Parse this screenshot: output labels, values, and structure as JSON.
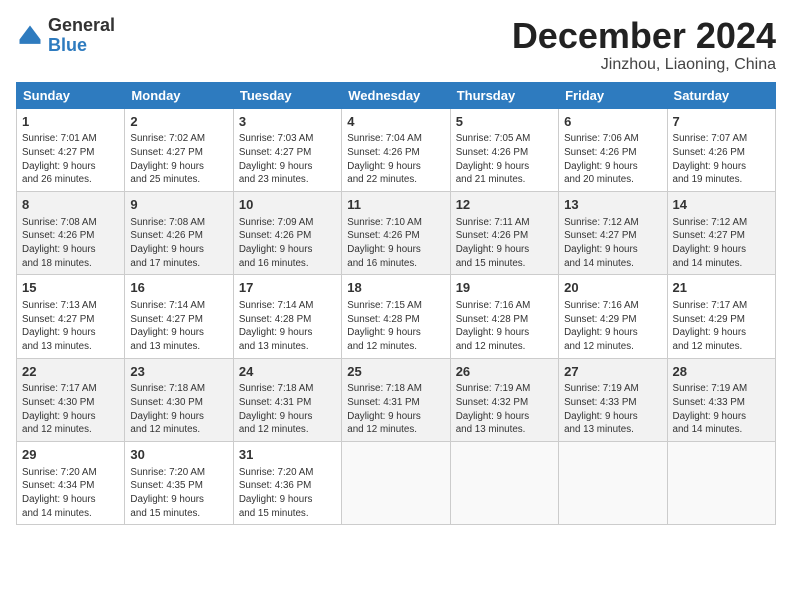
{
  "header": {
    "logo_general": "General",
    "logo_blue": "Blue",
    "month_title": "December 2024",
    "location": "Jinzhou, Liaoning, China"
  },
  "weekdays": [
    "Sunday",
    "Monday",
    "Tuesday",
    "Wednesday",
    "Thursday",
    "Friday",
    "Saturday"
  ],
  "rows": [
    [
      {
        "day": "1",
        "info": "Sunrise: 7:01 AM\nSunset: 4:27 PM\nDaylight: 9 hours\nand 26 minutes."
      },
      {
        "day": "2",
        "info": "Sunrise: 7:02 AM\nSunset: 4:27 PM\nDaylight: 9 hours\nand 25 minutes."
      },
      {
        "day": "3",
        "info": "Sunrise: 7:03 AM\nSunset: 4:27 PM\nDaylight: 9 hours\nand 23 minutes."
      },
      {
        "day": "4",
        "info": "Sunrise: 7:04 AM\nSunset: 4:26 PM\nDaylight: 9 hours\nand 22 minutes."
      },
      {
        "day": "5",
        "info": "Sunrise: 7:05 AM\nSunset: 4:26 PM\nDaylight: 9 hours\nand 21 minutes."
      },
      {
        "day": "6",
        "info": "Sunrise: 7:06 AM\nSunset: 4:26 PM\nDaylight: 9 hours\nand 20 minutes."
      },
      {
        "day": "7",
        "info": "Sunrise: 7:07 AM\nSunset: 4:26 PM\nDaylight: 9 hours\nand 19 minutes."
      }
    ],
    [
      {
        "day": "8",
        "info": "Sunrise: 7:08 AM\nSunset: 4:26 PM\nDaylight: 9 hours\nand 18 minutes."
      },
      {
        "day": "9",
        "info": "Sunrise: 7:08 AM\nSunset: 4:26 PM\nDaylight: 9 hours\nand 17 minutes."
      },
      {
        "day": "10",
        "info": "Sunrise: 7:09 AM\nSunset: 4:26 PM\nDaylight: 9 hours\nand 16 minutes."
      },
      {
        "day": "11",
        "info": "Sunrise: 7:10 AM\nSunset: 4:26 PM\nDaylight: 9 hours\nand 16 minutes."
      },
      {
        "day": "12",
        "info": "Sunrise: 7:11 AM\nSunset: 4:26 PM\nDaylight: 9 hours\nand 15 minutes."
      },
      {
        "day": "13",
        "info": "Sunrise: 7:12 AM\nSunset: 4:27 PM\nDaylight: 9 hours\nand 14 minutes."
      },
      {
        "day": "14",
        "info": "Sunrise: 7:12 AM\nSunset: 4:27 PM\nDaylight: 9 hours\nand 14 minutes."
      }
    ],
    [
      {
        "day": "15",
        "info": "Sunrise: 7:13 AM\nSunset: 4:27 PM\nDaylight: 9 hours\nand 13 minutes."
      },
      {
        "day": "16",
        "info": "Sunrise: 7:14 AM\nSunset: 4:27 PM\nDaylight: 9 hours\nand 13 minutes."
      },
      {
        "day": "17",
        "info": "Sunrise: 7:14 AM\nSunset: 4:28 PM\nDaylight: 9 hours\nand 13 minutes."
      },
      {
        "day": "18",
        "info": "Sunrise: 7:15 AM\nSunset: 4:28 PM\nDaylight: 9 hours\nand 12 minutes."
      },
      {
        "day": "19",
        "info": "Sunrise: 7:16 AM\nSunset: 4:28 PM\nDaylight: 9 hours\nand 12 minutes."
      },
      {
        "day": "20",
        "info": "Sunrise: 7:16 AM\nSunset: 4:29 PM\nDaylight: 9 hours\nand 12 minutes."
      },
      {
        "day": "21",
        "info": "Sunrise: 7:17 AM\nSunset: 4:29 PM\nDaylight: 9 hours\nand 12 minutes."
      }
    ],
    [
      {
        "day": "22",
        "info": "Sunrise: 7:17 AM\nSunset: 4:30 PM\nDaylight: 9 hours\nand 12 minutes."
      },
      {
        "day": "23",
        "info": "Sunrise: 7:18 AM\nSunset: 4:30 PM\nDaylight: 9 hours\nand 12 minutes."
      },
      {
        "day": "24",
        "info": "Sunrise: 7:18 AM\nSunset: 4:31 PM\nDaylight: 9 hours\nand 12 minutes."
      },
      {
        "day": "25",
        "info": "Sunrise: 7:18 AM\nSunset: 4:31 PM\nDaylight: 9 hours\nand 12 minutes."
      },
      {
        "day": "26",
        "info": "Sunrise: 7:19 AM\nSunset: 4:32 PM\nDaylight: 9 hours\nand 13 minutes."
      },
      {
        "day": "27",
        "info": "Sunrise: 7:19 AM\nSunset: 4:33 PM\nDaylight: 9 hours\nand 13 minutes."
      },
      {
        "day": "28",
        "info": "Sunrise: 7:19 AM\nSunset: 4:33 PM\nDaylight: 9 hours\nand 14 minutes."
      }
    ],
    [
      {
        "day": "29",
        "info": "Sunrise: 7:20 AM\nSunset: 4:34 PM\nDaylight: 9 hours\nand 14 minutes."
      },
      {
        "day": "30",
        "info": "Sunrise: 7:20 AM\nSunset: 4:35 PM\nDaylight: 9 hours\nand 15 minutes."
      },
      {
        "day": "31",
        "info": "Sunrise: 7:20 AM\nSunset: 4:36 PM\nDaylight: 9 hours\nand 15 minutes."
      },
      null,
      null,
      null,
      null
    ]
  ]
}
